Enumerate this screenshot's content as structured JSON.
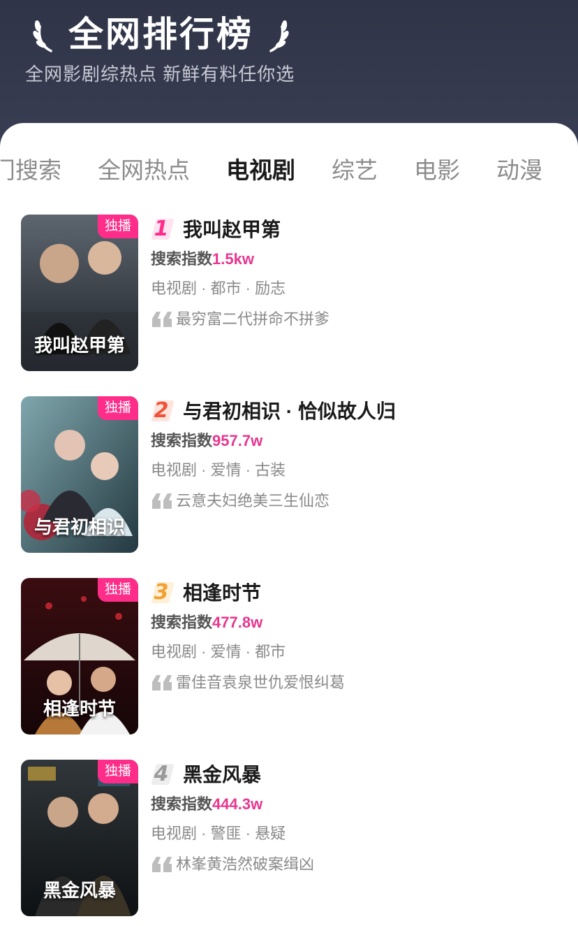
{
  "header": {
    "title": "全网排行榜",
    "subtitle": "全网影剧综热点  新鲜有料任你选"
  },
  "tabs": [
    {
      "label": "热门搜索",
      "active": false
    },
    {
      "label": "全网热点",
      "active": false
    },
    {
      "label": "电视剧",
      "active": true
    },
    {
      "label": "综艺",
      "active": false
    },
    {
      "label": "电影",
      "active": false
    },
    {
      "label": "动漫",
      "active": false
    }
  ],
  "items": [
    {
      "rank": "1",
      "title": "我叫赵甲第",
      "search_label": "搜索指数",
      "search_value": "1.5kw",
      "genre": "电视剧 · 都市 · 励志",
      "quote": "最穷富二代拼命不拼爹",
      "badge": "独播",
      "poster_text": "我叫赵甲第"
    },
    {
      "rank": "2",
      "title": "与君初相识 · 恰似故人归",
      "search_label": "搜索指数",
      "search_value": "957.7w",
      "genre": "电视剧 · 爱情 · 古装",
      "quote": "云意夫妇绝美三生仙恋",
      "badge": "独播",
      "poster_text": "与君初相识"
    },
    {
      "rank": "3",
      "title": "相逢时节",
      "search_label": "搜索指数",
      "search_value": "477.8w",
      "genre": "电视剧 · 爱情 · 都市",
      "quote": "雷佳音袁泉世仇爱恨纠葛",
      "badge": "独播",
      "poster_text": "相逢时节"
    },
    {
      "rank": "4",
      "title": "黑金风暴",
      "search_label": "搜索指数",
      "search_value": "444.3w",
      "genre": "电视剧 · 警匪 · 悬疑",
      "quote": "林峯黄浩然破案缉凶",
      "badge": "独播",
      "poster_text": "黑金风暴"
    }
  ],
  "colors": {
    "header_bg": "#2f3447",
    "accent_pink": "#e8368f",
    "badge_pink": "#ff2d8a",
    "rank1": "#ff2d8a",
    "rank2": "#f0533a",
    "rank3": "#f2a031",
    "rank4": "#9a9a9a"
  },
  "icons": {
    "laurel_left": "laurel-left-icon",
    "laurel_right": "laurel-right-icon",
    "quote": "quote-icon"
  }
}
